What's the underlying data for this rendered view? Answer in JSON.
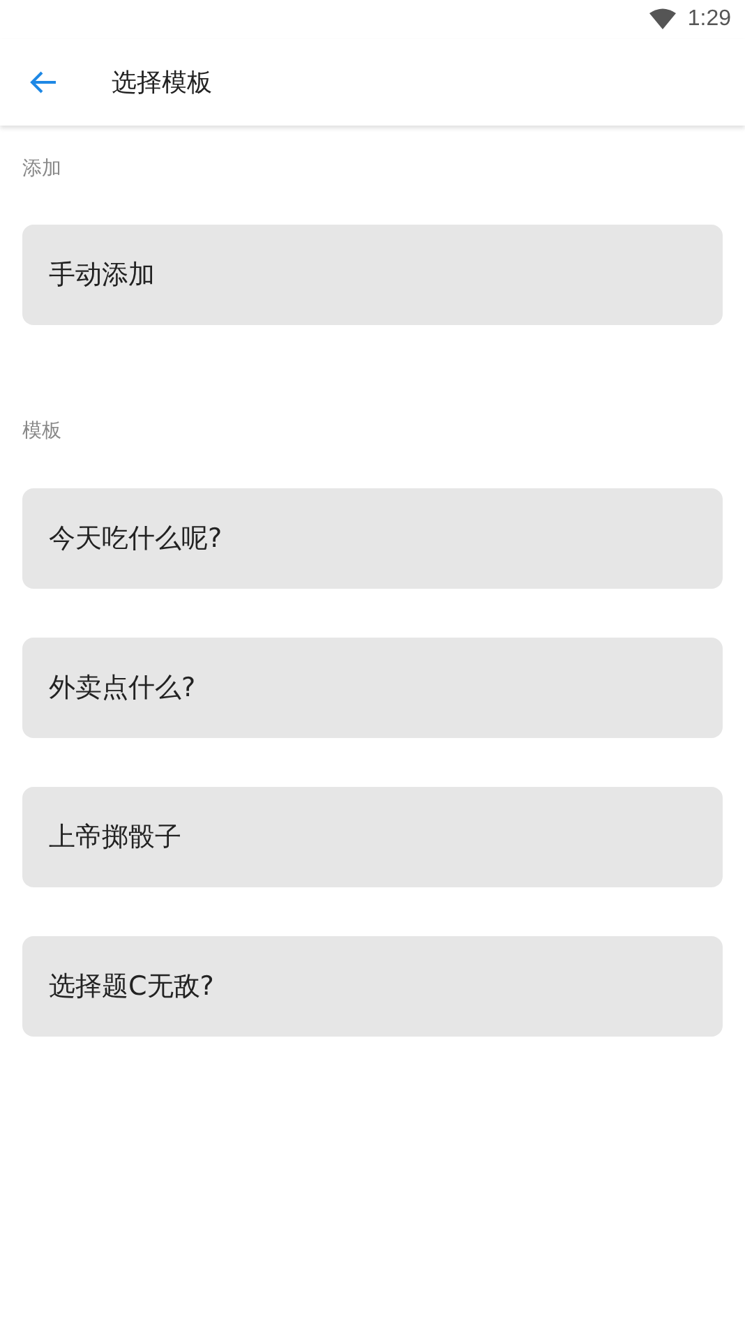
{
  "status_bar": {
    "time": "1:29"
  },
  "app_bar": {
    "title": "选择模板"
  },
  "sections": [
    {
      "title": "添加",
      "items": [
        {
          "label": "手动添加"
        }
      ]
    },
    {
      "title": "模板",
      "items": [
        {
          "label": "今天吃什么呢?"
        },
        {
          "label": "外卖点什么?"
        },
        {
          "label": "上帝掷骰子"
        },
        {
          "label": "选择题C无敌?"
        }
      ]
    }
  ]
}
